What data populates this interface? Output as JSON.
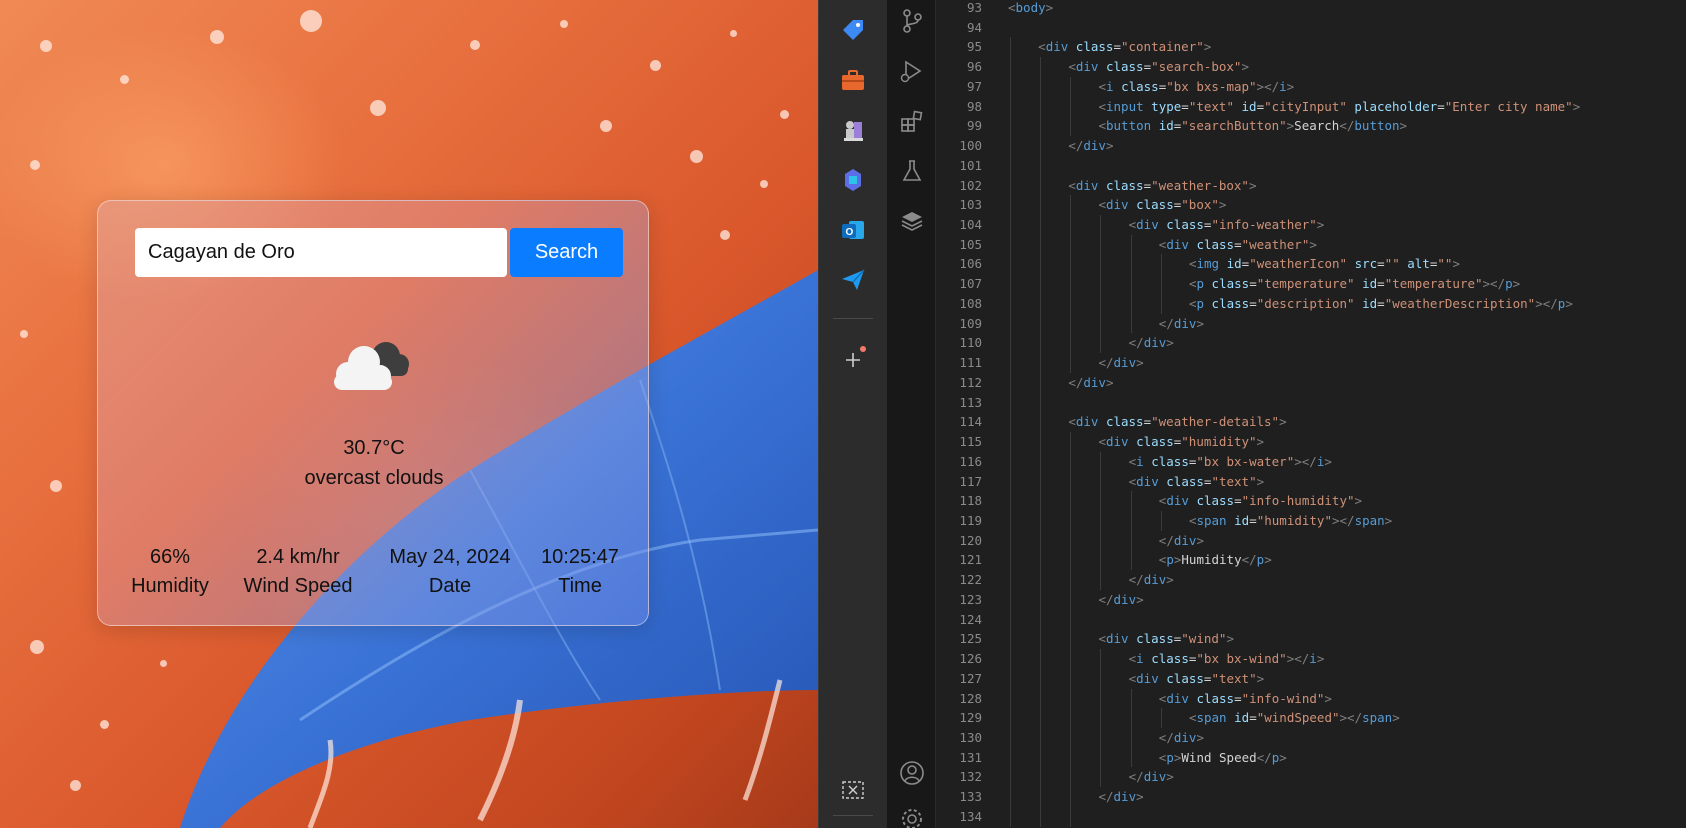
{
  "weather_app": {
    "city_value": "Cagayan de Oro",
    "search_label": "Search",
    "weather_icon": "overcast-clouds-icon",
    "temperature": "30.7°C",
    "description": "overcast clouds",
    "details": [
      {
        "value": "66%",
        "label": "Humidity"
      },
      {
        "value": "2.4 km/hr",
        "label": "Wind Speed"
      },
      {
        "value": "May 24, 2024",
        "label": "Date"
      },
      {
        "value": "10:25:47",
        "label": "Time"
      }
    ]
  },
  "activity_bar_left": {
    "icons": [
      "tag-icon",
      "toolbox-icon",
      "chess-icon",
      "copilot-icon",
      "outlook-icon",
      "send-icon",
      "add-icon",
      "snipping-tool-icon"
    ]
  },
  "activity_bar_right": {
    "icons": [
      "source-control-icon",
      "run-debug-icon",
      "extensions-icon",
      "testing-icon",
      "layers-icon",
      "account-icon",
      "settings-icon"
    ]
  },
  "editor": {
    "lines": [
      {
        "n": "93",
        "indent": 0,
        "html": "<span class=\"tok-b\">&lt;</span><span class=\"tok-t\">body</span><span class=\"tok-b\">&gt;</span>"
      },
      {
        "n": "94",
        "indent": 0,
        "html": ""
      },
      {
        "n": "95",
        "indent": 1,
        "html": "<span class=\"tok-b\">&lt;</span><span class=\"tok-t\">div</span> <span class=\"tok-a\">class</span><span class=\"tok-x\">=</span><span class=\"tok-s\">\"container\"</span><span class=\"tok-b\">&gt;</span>"
      },
      {
        "n": "96",
        "indent": 2,
        "html": "<span class=\"tok-b\">&lt;</span><span class=\"tok-t\">div</span> <span class=\"tok-a\">class</span><span class=\"tok-x\">=</span><span class=\"tok-s\">\"search-box\"</span><span class=\"tok-b\">&gt;</span>"
      },
      {
        "n": "97",
        "indent": 3,
        "html": "<span class=\"tok-b\">&lt;</span><span class=\"tok-t\">i</span> <span class=\"tok-a\">class</span><span class=\"tok-x\">=</span><span class=\"tok-s\">\"bx bxs-map\"</span><span class=\"tok-b\">&gt;&lt;/</span><span class=\"tok-t\">i</span><span class=\"tok-b\">&gt;</span>"
      },
      {
        "n": "98",
        "indent": 3,
        "html": "<span class=\"tok-b\">&lt;</span><span class=\"tok-t\">input</span> <span class=\"tok-a\">type</span><span class=\"tok-x\">=</span><span class=\"tok-s\">\"text\"</span> <span class=\"tok-a\">id</span><span class=\"tok-x\">=</span><span class=\"tok-s\">\"cityInput\"</span> <span class=\"tok-a\">placeholder</span><span class=\"tok-x\">=</span><span class=\"tok-s\">\"Enter city name\"</span><span class=\"tok-b\">&gt;</span>"
      },
      {
        "n": "99",
        "indent": 3,
        "html": "<span class=\"tok-b\">&lt;</span><span class=\"tok-t\">button</span> <span class=\"tok-a\">id</span><span class=\"tok-x\">=</span><span class=\"tok-s\">\"searchButton\"</span><span class=\"tok-b\">&gt;</span><span class=\"tok-x\">Search</span><span class=\"tok-b\">&lt;/</span><span class=\"tok-t\">button</span><span class=\"tok-b\">&gt;</span>"
      },
      {
        "n": "100",
        "indent": 2,
        "html": "<span class=\"tok-b\">&lt;/</span><span class=\"tok-t\">div</span><span class=\"tok-b\">&gt;</span>"
      },
      {
        "n": "101",
        "indent": 2,
        "html": ""
      },
      {
        "n": "102",
        "indent": 2,
        "html": "<span class=\"tok-b\">&lt;</span><span class=\"tok-t\">div</span> <span class=\"tok-a\">class</span><span class=\"tok-x\">=</span><span class=\"tok-s\">\"weather-box\"</span><span class=\"tok-b\">&gt;</span>"
      },
      {
        "n": "103",
        "indent": 3,
        "html": "<span class=\"tok-b\">&lt;</span><span class=\"tok-t\">div</span> <span class=\"tok-a\">class</span><span class=\"tok-x\">=</span><span class=\"tok-s\">\"box\"</span><span class=\"tok-b\">&gt;</span>"
      },
      {
        "n": "104",
        "indent": 4,
        "html": "<span class=\"tok-b\">&lt;</span><span class=\"tok-t\">div</span> <span class=\"tok-a\">class</span><span class=\"tok-x\">=</span><span class=\"tok-s\">\"info-weather\"</span><span class=\"tok-b\">&gt;</span>"
      },
      {
        "n": "105",
        "indent": 5,
        "html": "<span class=\"tok-b\">&lt;</span><span class=\"tok-t\">div</span> <span class=\"tok-a\">class</span><span class=\"tok-x\">=</span><span class=\"tok-s\">\"weather\"</span><span class=\"tok-b\">&gt;</span>"
      },
      {
        "n": "106",
        "indent": 6,
        "html": "<span class=\"tok-b\">&lt;</span><span class=\"tok-t\">img</span> <span class=\"tok-a\">id</span><span class=\"tok-x\">=</span><span class=\"tok-s\">\"weatherIcon\"</span> <span class=\"tok-a\">src</span><span class=\"tok-x\">=</span><span class=\"tok-s\">\"\"</span> <span class=\"tok-a\">alt</span><span class=\"tok-x\">=</span><span class=\"tok-s\">\"\"</span><span class=\"tok-b\">&gt;</span>"
      },
      {
        "n": "107",
        "indent": 6,
        "html": "<span class=\"tok-b\">&lt;</span><span class=\"tok-t\">p</span> <span class=\"tok-a\">class</span><span class=\"tok-x\">=</span><span class=\"tok-s\">\"temperature\"</span> <span class=\"tok-a\">id</span><span class=\"tok-x\">=</span><span class=\"tok-s\">\"temperature\"</span><span class=\"tok-b\">&gt;&lt;/</span><span class=\"tok-t\">p</span><span class=\"tok-b\">&gt;</span>"
      },
      {
        "n": "108",
        "indent": 6,
        "html": "<span class=\"tok-b\">&lt;</span><span class=\"tok-t\">p</span> <span class=\"tok-a\">class</span><span class=\"tok-x\">=</span><span class=\"tok-s\">\"description\"</span> <span class=\"tok-a\">id</span><span class=\"tok-x\">=</span><span class=\"tok-s\">\"weatherDescription\"</span><span class=\"tok-b\">&gt;&lt;/</span><span class=\"tok-t\">p</span><span class=\"tok-b\">&gt;</span>"
      },
      {
        "n": "109",
        "indent": 5,
        "html": "<span class=\"tok-b\">&lt;/</span><span class=\"tok-t\">div</span><span class=\"tok-b\">&gt;</span>"
      },
      {
        "n": "110",
        "indent": 4,
        "html": "<span class=\"tok-b\">&lt;/</span><span class=\"tok-t\">div</span><span class=\"tok-b\">&gt;</span>"
      },
      {
        "n": "111",
        "indent": 3,
        "html": "<span class=\"tok-b\">&lt;/</span><span class=\"tok-t\">div</span><span class=\"tok-b\">&gt;</span>"
      },
      {
        "n": "112",
        "indent": 2,
        "html": "<span class=\"tok-b\">&lt;/</span><span class=\"tok-t\">div</span><span class=\"tok-b\">&gt;</span>"
      },
      {
        "n": "113",
        "indent": 2,
        "html": ""
      },
      {
        "n": "114",
        "indent": 2,
        "html": "<span class=\"tok-b\">&lt;</span><span class=\"tok-t\">div</span> <span class=\"tok-a\">class</span><span class=\"tok-x\">=</span><span class=\"tok-s\">\"weather-details\"</span><span class=\"tok-b\">&gt;</span>"
      },
      {
        "n": "115",
        "indent": 3,
        "html": "<span class=\"tok-b\">&lt;</span><span class=\"tok-t\">div</span> <span class=\"tok-a\">class</span><span class=\"tok-x\">=</span><span class=\"tok-s\">\"humidity\"</span><span class=\"tok-b\">&gt;</span>"
      },
      {
        "n": "116",
        "indent": 4,
        "html": "<span class=\"tok-b\">&lt;</span><span class=\"tok-t\">i</span> <span class=\"tok-a\">class</span><span class=\"tok-x\">=</span><span class=\"tok-s\">\"bx bx-water\"</span><span class=\"tok-b\">&gt;&lt;/</span><span class=\"tok-t\">i</span><span class=\"tok-b\">&gt;</span>"
      },
      {
        "n": "117",
        "indent": 4,
        "html": "<span class=\"tok-b\">&lt;</span><span class=\"tok-t\">div</span> <span class=\"tok-a\">class</span><span class=\"tok-x\">=</span><span class=\"tok-s\">\"text\"</span><span class=\"tok-b\">&gt;</span>"
      },
      {
        "n": "118",
        "indent": 5,
        "html": "<span class=\"tok-b\">&lt;</span><span class=\"tok-t\">div</span> <span class=\"tok-a\">class</span><span class=\"tok-x\">=</span><span class=\"tok-s\">\"info-humidity\"</span><span class=\"tok-b\">&gt;</span>"
      },
      {
        "n": "119",
        "indent": 6,
        "html": "<span class=\"tok-b\">&lt;</span><span class=\"tok-t\">span</span> <span class=\"tok-a\">id</span><span class=\"tok-x\">=</span><span class=\"tok-s\">\"humidity\"</span><span class=\"tok-b\">&gt;&lt;/</span><span class=\"tok-t\">span</span><span class=\"tok-b\">&gt;</span>"
      },
      {
        "n": "120",
        "indent": 5,
        "html": "<span class=\"tok-b\">&lt;/</span><span class=\"tok-t\">div</span><span class=\"tok-b\">&gt;</span>"
      },
      {
        "n": "121",
        "indent": 5,
        "html": "<span class=\"tok-b\">&lt;</span><span class=\"tok-t\">p</span><span class=\"tok-b\">&gt;</span><span class=\"tok-x\">Humidity</span><span class=\"tok-b\">&lt;/</span><span class=\"tok-t\">p</span><span class=\"tok-b\">&gt;</span>"
      },
      {
        "n": "122",
        "indent": 4,
        "html": "<span class=\"tok-b\">&lt;/</span><span class=\"tok-t\">div</span><span class=\"tok-b\">&gt;</span>"
      },
      {
        "n": "123",
        "indent": 3,
        "html": "<span class=\"tok-b\">&lt;/</span><span class=\"tok-t\">div</span><span class=\"tok-b\">&gt;</span>"
      },
      {
        "n": "124",
        "indent": 3,
        "html": ""
      },
      {
        "n": "125",
        "indent": 3,
        "html": "<span class=\"tok-b\">&lt;</span><span class=\"tok-t\">div</span> <span class=\"tok-a\">class</span><span class=\"tok-x\">=</span><span class=\"tok-s\">\"wind\"</span><span class=\"tok-b\">&gt;</span>"
      },
      {
        "n": "126",
        "indent": 4,
        "html": "<span class=\"tok-b\">&lt;</span><span class=\"tok-t\">i</span> <span class=\"tok-a\">class</span><span class=\"tok-x\">=</span><span class=\"tok-s\">\"bx bx-wind\"</span><span class=\"tok-b\">&gt;&lt;/</span><span class=\"tok-t\">i</span><span class=\"tok-b\">&gt;</span>"
      },
      {
        "n": "127",
        "indent": 4,
        "html": "<span class=\"tok-b\">&lt;</span><span class=\"tok-t\">div</span> <span class=\"tok-a\">class</span><span class=\"tok-x\">=</span><span class=\"tok-s\">\"text\"</span><span class=\"tok-b\">&gt;</span>"
      },
      {
        "n": "128",
        "indent": 5,
        "html": "<span class=\"tok-b\">&lt;</span><span class=\"tok-t\">div</span> <span class=\"tok-a\">class</span><span class=\"tok-x\">=</span><span class=\"tok-s\">\"info-wind\"</span><span class=\"tok-b\">&gt;</span>"
      },
      {
        "n": "129",
        "indent": 6,
        "html": "<span class=\"tok-b\">&lt;</span><span class=\"tok-t\">span</span> <span class=\"tok-a\">id</span><span class=\"tok-x\">=</span><span class=\"tok-s\">\"windSpeed\"</span><span class=\"tok-b\">&gt;&lt;/</span><span class=\"tok-t\">span</span><span class=\"tok-b\">&gt;</span>"
      },
      {
        "n": "130",
        "indent": 5,
        "html": "<span class=\"tok-b\">&lt;/</span><span class=\"tok-t\">div</span><span class=\"tok-b\">&gt;</span>"
      },
      {
        "n": "131",
        "indent": 5,
        "html": "<span class=\"tok-b\">&lt;</span><span class=\"tok-t\">p</span><span class=\"tok-b\">&gt;</span><span class=\"tok-x\">Wind Speed</span><span class=\"tok-b\">&lt;/</span><span class=\"tok-t\">p</span><span class=\"tok-b\">&gt;</span>"
      },
      {
        "n": "132",
        "indent": 4,
        "html": "<span class=\"tok-b\">&lt;/</span><span class=\"tok-t\">div</span><span class=\"tok-b\">&gt;</span>"
      },
      {
        "n": "133",
        "indent": 3,
        "html": "<span class=\"tok-b\">&lt;/</span><span class=\"tok-t\">div</span><span class=\"tok-b\">&gt;</span>"
      },
      {
        "n": "134",
        "indent": 3,
        "html": ""
      }
    ]
  }
}
